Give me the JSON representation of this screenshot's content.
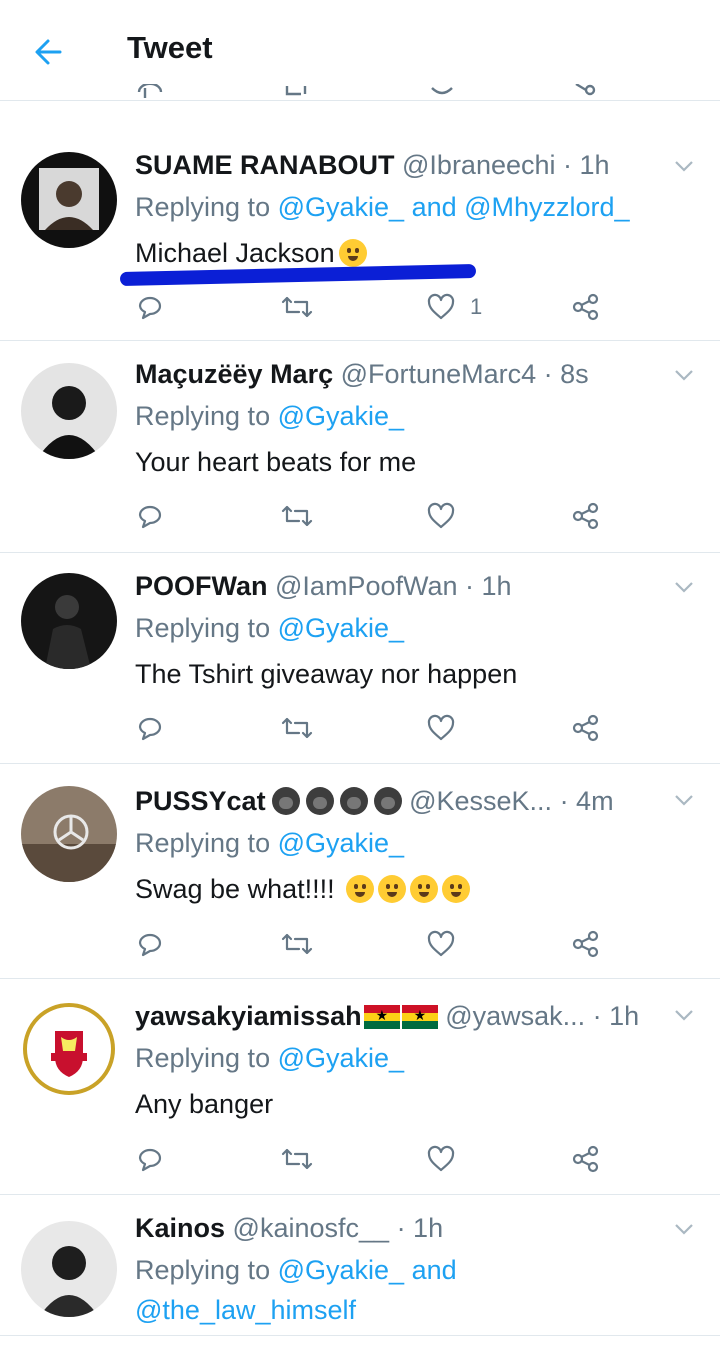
{
  "header": {
    "title": "Tweet",
    "back_icon": "arrow-left-icon"
  },
  "tweets": [
    {
      "name": "SUAME RANABOUT",
      "handle": "@Ibraneechi",
      "time": "· 1h",
      "reply_prefix": "Replying to",
      "mentions": "@Gyakie_ and @Mhyzzlord_",
      "mentions_line2": "",
      "text": "Michael Jackson",
      "like_count": "1"
    },
    {
      "name": "Maçuzëëy Març",
      "handle": "@FortuneMarc4",
      "time": "· 8s",
      "reply_prefix": "Replying to",
      "mentions": "@Gyakie_",
      "text": "Your heart beats for me"
    },
    {
      "name": "POOFWan",
      "handle": "@IamPoofWan",
      "time": "· 1h",
      "reply_prefix": "Replying to",
      "mentions": "@Gyakie_",
      "text": "The Tshirt giveaway nor happen"
    },
    {
      "name": "PUSSYcat",
      "handle": "@KesseK...",
      "time": "· 4m",
      "reply_prefix": "Replying to",
      "mentions": "@Gyakie_",
      "text": "Swag be what!!!!"
    },
    {
      "name": "yawsakyiamissah",
      "handle": "@yawsak...",
      "time": "· 1h",
      "reply_prefix": "Replying to",
      "mentions": "@Gyakie_",
      "text": "Any banger"
    },
    {
      "name": "Kainos",
      "handle": "@kainosfc__",
      "time": "· 1h",
      "reply_prefix": "Replying to",
      "mentions": "@Gyakie_ and",
      "mentions_line2": "@the_law_himself"
    }
  ],
  "colors": {
    "accent": "#1da1f2",
    "muted": "#657786",
    "text": "#14171a",
    "divider": "#e1e8ed",
    "highlight": "#0b1fd6"
  },
  "icons": {
    "reply": "reply-icon",
    "retweet": "retweet-icon",
    "like": "heart-icon",
    "share": "share-icon",
    "caret": "chevron-down-icon"
  }
}
